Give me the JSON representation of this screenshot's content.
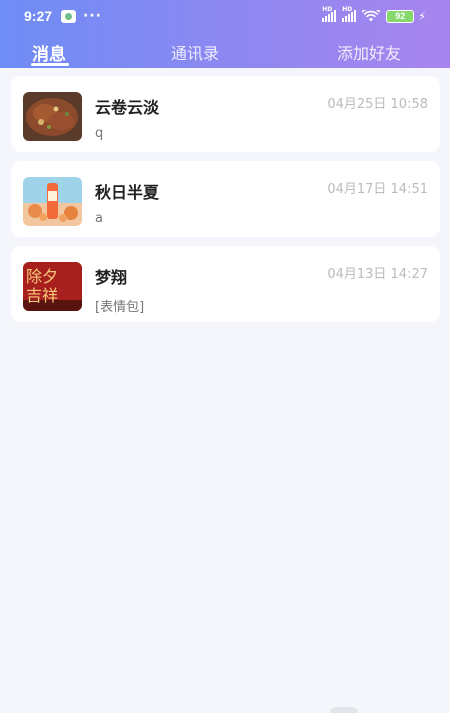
{
  "status_bar": {
    "time": "9:27",
    "dots": "···",
    "battery": "92",
    "hd1": "HD",
    "hd2": "HD"
  },
  "tabs": [
    {
      "label": "消息",
      "active": true
    },
    {
      "label": "通讯录",
      "active": false
    },
    {
      "label": "添加好友",
      "active": false
    }
  ],
  "conversations": [
    {
      "name": "云卷云淡",
      "preview": "q",
      "time": "04月25日 10:58"
    },
    {
      "name": "秋日半夏",
      "preview": "a",
      "time": "04月17日 14:51"
    },
    {
      "name": "梦翔",
      "preview": "[表情包]",
      "time": "04月13日 14:27",
      "avatar_text": "除夕吉祥"
    }
  ],
  "colors": {
    "header_start": "#6e8df5",
    "header_end": "#a885ee",
    "background": "#f4f6fb"
  }
}
